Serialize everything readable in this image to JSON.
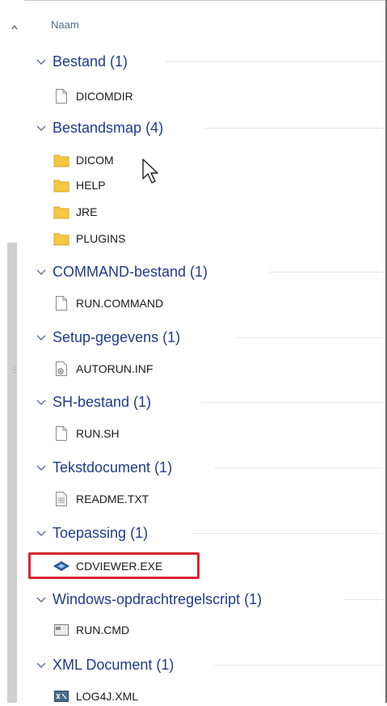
{
  "header": {
    "column_name": "Naam"
  },
  "groups": [
    {
      "title": "Bestand (1)",
      "files": [
        {
          "name": "DICOMDIR",
          "icon": "blank-file-icon"
        }
      ]
    },
    {
      "title": "Bestandsmap (4)",
      "files": [
        {
          "name": "DICOM",
          "icon": "folder-icon"
        },
        {
          "name": "HELP",
          "icon": "folder-icon"
        },
        {
          "name": "JRE",
          "icon": "folder-icon"
        },
        {
          "name": "PLUGINS",
          "icon": "folder-icon"
        }
      ]
    },
    {
      "title": "COMMAND-bestand (1)",
      "files": [
        {
          "name": "RUN.COMMAND",
          "icon": "blank-file-icon"
        }
      ]
    },
    {
      "title": "Setup-gegevens (1)",
      "files": [
        {
          "name": "AUTORUN.INF",
          "icon": "settings-file-icon"
        }
      ]
    },
    {
      "title": "SH-bestand (1)",
      "files": [
        {
          "name": "RUN.SH",
          "icon": "blank-file-icon"
        }
      ]
    },
    {
      "title": "Tekstdocument (1)",
      "files": [
        {
          "name": "README.TXT",
          "icon": "text-file-icon"
        }
      ]
    },
    {
      "title": "Toepassing (1)",
      "files": [
        {
          "name": "CDVIEWER.EXE",
          "icon": "app-icon"
        }
      ]
    },
    {
      "title": "Windows-opdrachtregelscript (1)",
      "files": [
        {
          "name": "RUN.CMD",
          "icon": "cmd-file-icon"
        }
      ]
    },
    {
      "title": "XML Document (1)",
      "files": [
        {
          "name": "LOG4J.XML",
          "icon": "xml-file-icon"
        }
      ]
    }
  ],
  "colors": {
    "group_title": "#1f3c8a",
    "highlight": "#d8242f",
    "folder": "#f5c842"
  }
}
